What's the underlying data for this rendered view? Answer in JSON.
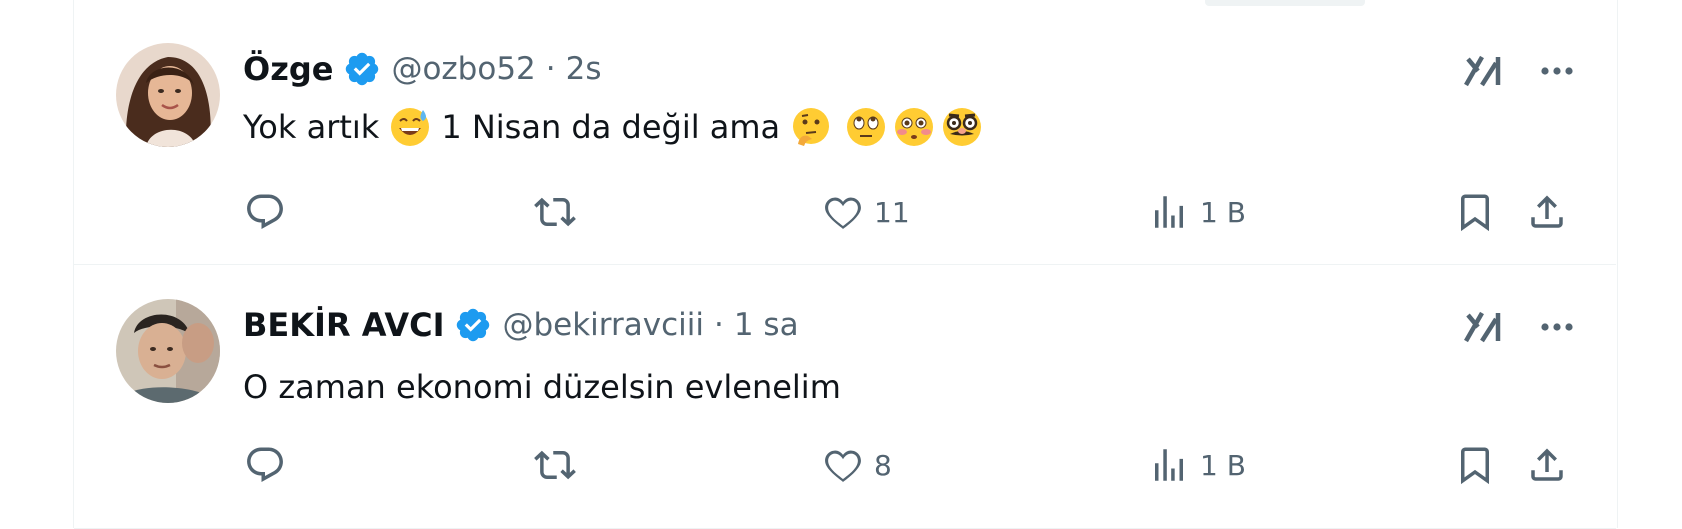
{
  "tweets": [
    {
      "name": "Özge",
      "handle": "@ozbo52",
      "separator": "·",
      "time": "2s",
      "text": "Yok artık",
      "text_after": "1 Nisan da değil ama",
      "emojis": [
        "grinning-face-with-sweat",
        "thinking-face",
        "face-with-rolling-eyes",
        "flushed-face",
        "disguised-face"
      ],
      "likes": "11",
      "views": "1 B"
    },
    {
      "name": "BEKİR AVCI",
      "handle": "@bekirravciii",
      "separator": "·",
      "time": "1 sa",
      "text": "O zaman ekonomi düzelsin evlenelim",
      "likes": "8",
      "views": "1 B"
    }
  ],
  "colors": {
    "verified": "#1d9bf0",
    "muted": "#536471",
    "text": "#0f1419",
    "divider": "#eff3f4"
  },
  "icons": {
    "reply": "reply-icon",
    "retweet": "retweet-icon",
    "like": "heart-icon",
    "views": "views-icon",
    "bookmark": "bookmark-icon",
    "share": "share-icon",
    "grok": "grok-icon",
    "more": "more-icon"
  }
}
